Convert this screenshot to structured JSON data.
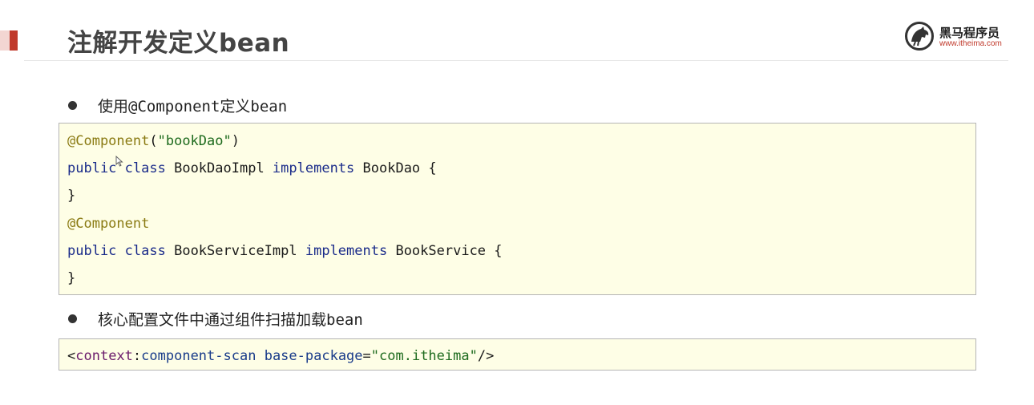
{
  "header": {
    "title": "注解开发定义bean",
    "logo_name": "黑马程序员",
    "logo_url": "www.itheima.com"
  },
  "bullets": [
    "使用@Component定义bean",
    "核心配置文件中通过组件扫描加载bean"
  ],
  "code_block_1": {
    "lines": [
      [
        {
          "t": "@Component",
          "c": "ann"
        },
        {
          "t": "(",
          "c": ""
        },
        {
          "t": "\"bookDao\"",
          "c": "str"
        },
        {
          "t": ")",
          "c": ""
        }
      ],
      [
        {
          "t": "public",
          "c": "kw"
        },
        {
          "t": " ",
          "c": ""
        },
        {
          "t": "class",
          "c": "kw"
        },
        {
          "t": " BookDaoImpl ",
          "c": ""
        },
        {
          "t": "implements",
          "c": "kw"
        },
        {
          "t": " BookDao {",
          "c": ""
        }
      ],
      [
        {
          "t": "}",
          "c": ""
        }
      ],
      [
        {
          "t": "@Component",
          "c": "ann"
        }
      ],
      [
        {
          "t": "public",
          "c": "kw"
        },
        {
          "t": " ",
          "c": ""
        },
        {
          "t": "class",
          "c": "kw"
        },
        {
          "t": " BookServiceImpl ",
          "c": ""
        },
        {
          "t": "implements",
          "c": "kw"
        },
        {
          "t": " BookService {",
          "c": ""
        }
      ],
      [
        {
          "t": "}",
          "c": ""
        }
      ]
    ]
  },
  "code_block_2": {
    "lines": [
      [
        {
          "t": "<",
          "c": ""
        },
        {
          "t": "context",
          "c": "tag"
        },
        {
          "t": ":",
          "c": ""
        },
        {
          "t": "component-scan",
          "c": "attr"
        },
        {
          "t": " ",
          "c": ""
        },
        {
          "t": "base-package",
          "c": "attr"
        },
        {
          "t": "=",
          "c": ""
        },
        {
          "t": "\"com.itheima\"",
          "c": "str"
        },
        {
          "t": "/>",
          "c": ""
        }
      ]
    ]
  },
  "colors": {
    "accent": "#c0392b",
    "code_background": "#fefee6",
    "annotation": "#8a7a12",
    "keyword": "#1a2b8a",
    "string": "#1e6b1e"
  },
  "icons": [
    "itheima-horse-logo-icon",
    "mouse-cursor-icon"
  ]
}
